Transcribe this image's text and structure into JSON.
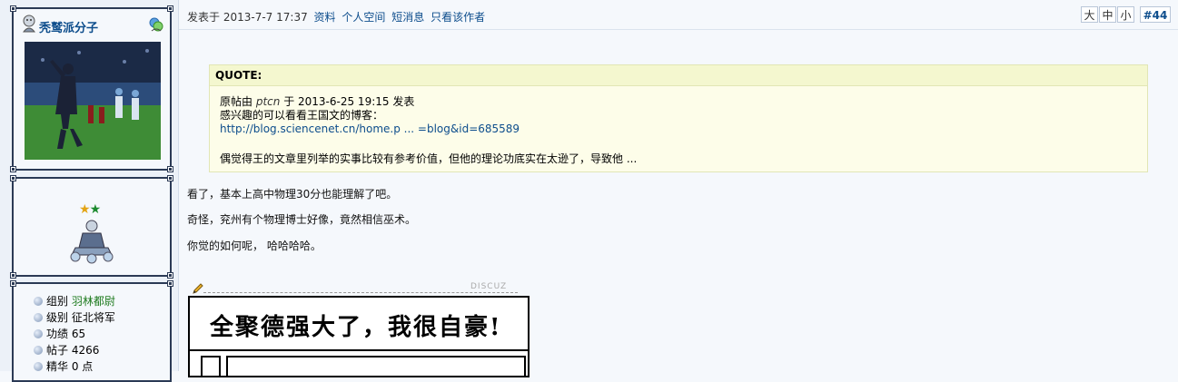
{
  "user": {
    "username": "秃鹫派分子",
    "group_label": "组别",
    "group_value": "羽林都尉",
    "level_label": "级别",
    "level_value": "征北将军",
    "merit_label": "功绩",
    "merit_value": "65",
    "posts_label": "帖子",
    "posts_value": "4266",
    "essence_label": "精华",
    "essence_value": "0 点"
  },
  "header": {
    "posted_prefix": "发表于",
    "posted_time": "2013-7-7 17:37",
    "links": [
      "资料",
      "个人空间",
      "短消息",
      "只看该作者"
    ],
    "size_buttons": [
      "大",
      "中",
      "小"
    ],
    "floor": "#44"
  },
  "quote": {
    "title": "QUOTE:",
    "line1_prefix": "原帖由",
    "line1_author": "ptcn",
    "line1_suffix": "于 2013-6-25 19:15 发表",
    "line2": "感兴趣的可以看看王国文的博客：",
    "link": "http://blog.sciencenet.cn/home.p ... =blog&id=685589",
    "line3": "偶觉得王的文章里列举的实事比较有参考价值，但他的理论功底实在太逊了，导致他 ..."
  },
  "body": {
    "lines": [
      "看了，基本上高中物理30分也能理解了吧。",
      "奇怪，兖州有个物理博士好像，竟然相信巫术。",
      "你觉的如何呢， 哈哈哈哈。"
    ],
    "tag": "DISCUZ",
    "comic_title": "全聚德强大了，我很自豪!"
  },
  "colors": {
    "link": "#0d4d8c",
    "frame_border": "#2b3a55",
    "quote_bg": "#fdfde9",
    "quote_title_bg": "#f4f7cf",
    "group_value": "#1d7a1d"
  }
}
